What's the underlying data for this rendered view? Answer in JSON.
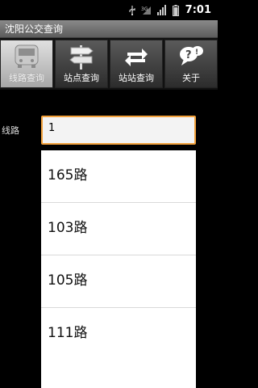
{
  "status_bar": {
    "time": "7:01",
    "network_label": "3G"
  },
  "app": {
    "title": "沈阳公交查询"
  },
  "tabs": [
    {
      "label": "线路查询",
      "icon": "bus-icon",
      "active": true
    },
    {
      "label": "站点查询",
      "icon": "signpost-icon",
      "active": false
    },
    {
      "label": "站站查询",
      "icon": "swap-arrows-icon",
      "active": false
    },
    {
      "label": "关于",
      "icon": "question-bubble-icon",
      "active": false
    }
  ],
  "form": {
    "route_label": "线路",
    "route_value": "1"
  },
  "suggestions": [
    "165路",
    "103路",
    "105路",
    "111路"
  ],
  "colors": {
    "input_border": "#f2a13c",
    "active_tab": "#d6d6d6"
  }
}
